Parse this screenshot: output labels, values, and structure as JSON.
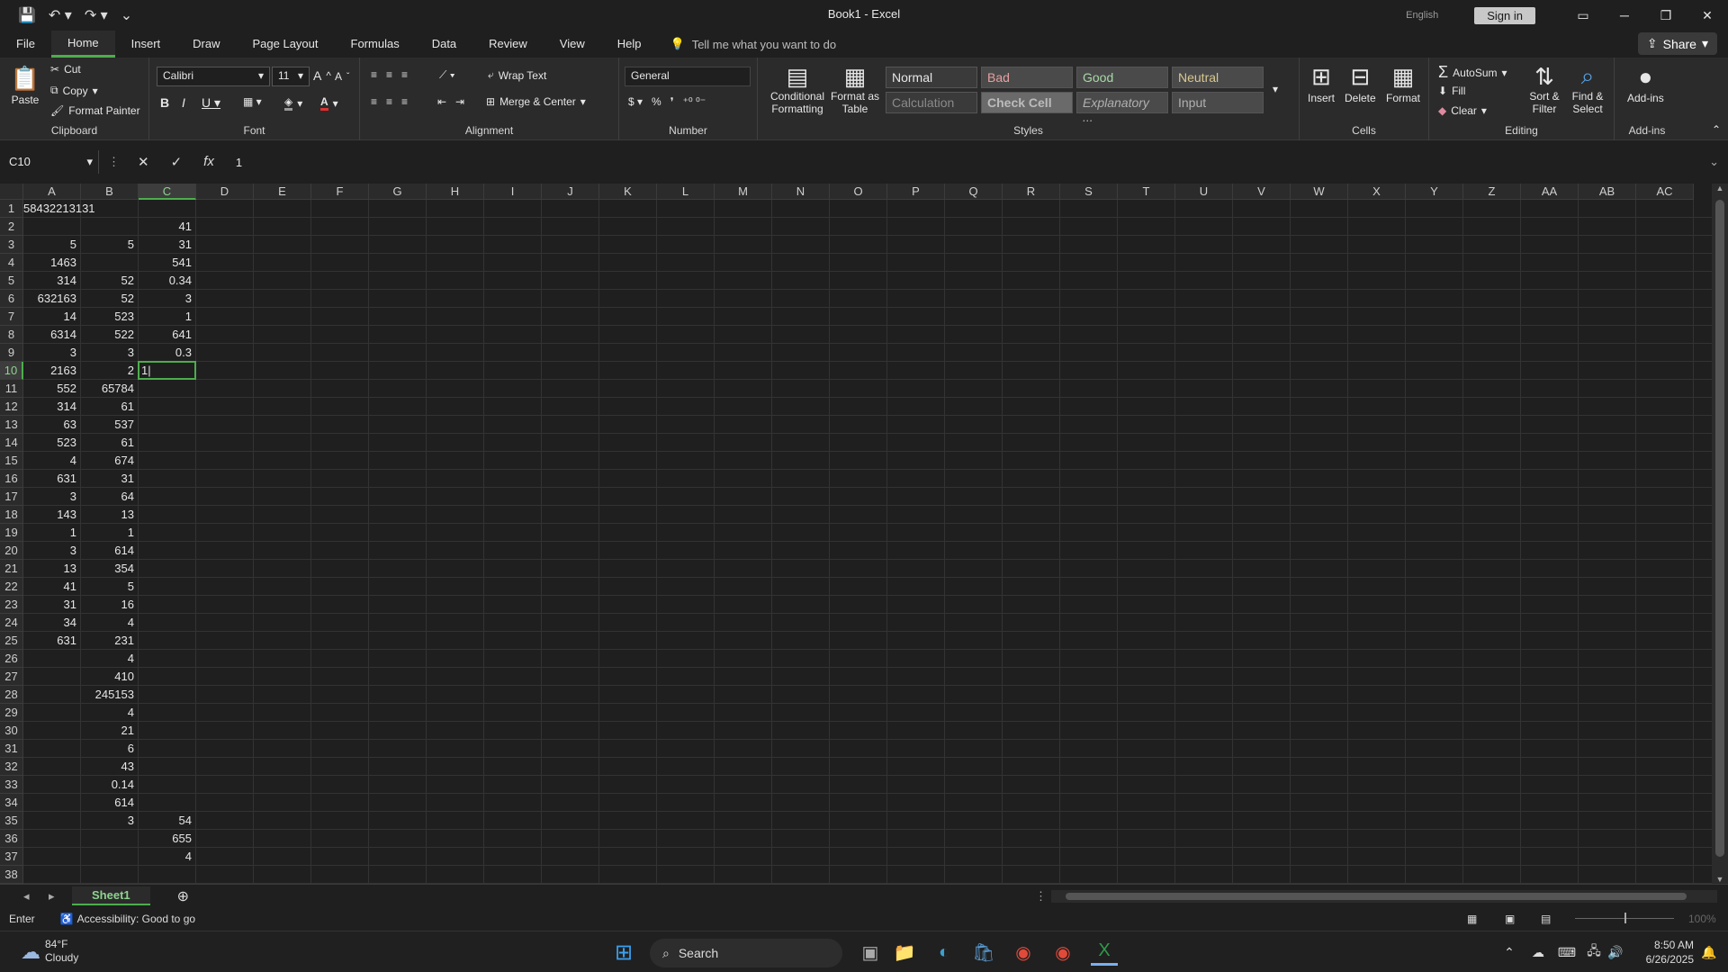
{
  "window": {
    "title": "Book1  -  Excel",
    "language": "English",
    "signin_label": "Sign in"
  },
  "tabs": [
    "File",
    "Home",
    "Insert",
    "Draw",
    "Page Layout",
    "Formulas",
    "Data",
    "Review",
    "View",
    "Help"
  ],
  "tellme": "Tell me what you want to do",
  "share_label": "Share",
  "ribbon": {
    "clipboard": {
      "paste": "Paste",
      "cut": "Cut",
      "copy": "Copy",
      "format_painter": "Format Painter",
      "label": "Clipboard"
    },
    "font": {
      "name": "Calibri",
      "size": "11",
      "label": "Font"
    },
    "alignment": {
      "wrap": "Wrap Text",
      "merge": "Merge & Center",
      "label": "Alignment"
    },
    "number": {
      "format": "General",
      "label": "Number"
    },
    "styles": {
      "conditional": "Conditional Formatting",
      "format_as_table": "Format as Table",
      "cells": [
        "Normal",
        "Bad",
        "Good",
        "Neutral",
        "Calculation",
        "Check Cell",
        "Explanatory ...",
        "Input"
      ],
      "label": "Styles"
    },
    "cells": {
      "insert": "Insert",
      "delete": "Delete",
      "format": "Format",
      "label": "Cells"
    },
    "editing": {
      "autosum": "AutoSum",
      "fill": "Fill",
      "clear": "Clear",
      "sort": "Sort & Filter",
      "find": "Find & Select",
      "label": "Editing"
    },
    "addins": {
      "addins": "Add-ins",
      "label": "Add-ins"
    }
  },
  "formula_bar": {
    "name_box": "C10",
    "formula": "1"
  },
  "columns": [
    "A",
    "B",
    "C",
    "D",
    "E",
    "F",
    "G",
    "H",
    "I",
    "J",
    "K",
    "L",
    "M",
    "N",
    "O",
    "P",
    "Q",
    "R",
    "S",
    "T",
    "U",
    "V",
    "W",
    "X",
    "Y",
    "Z",
    "AA",
    "AB",
    "AC"
  ],
  "rows": [
    "1",
    "2",
    "3",
    "4",
    "5",
    "6",
    "7",
    "8",
    "9",
    "10",
    "11",
    "12",
    "13",
    "14",
    "15",
    "16",
    "17",
    "18",
    "19",
    "20",
    "21",
    "22",
    "23",
    "24",
    "25",
    "26",
    "27",
    "28",
    "29",
    "30",
    "31",
    "32",
    "33",
    "34",
    "35",
    "36",
    "37",
    "38"
  ],
  "col_a": [
    "58432213131",
    "",
    "5",
    "1463",
    "314",
    "632163",
    "14",
    "6314",
    "3",
    "2163",
    "552",
    "314",
    "63",
    "523",
    "4",
    "631",
    "3",
    "143",
    "1",
    "3",
    "13",
    "41",
    "31",
    "34",
    "631",
    "",
    "",
    "",
    "",
    "",
    "",
    "",
    "",
    "",
    "",
    "",
    "",
    ""
  ],
  "col_b": [
    "",
    "",
    "5",
    "",
    "52",
    "52",
    "523",
    "522",
    "3",
    "2",
    "65784",
    "61",
    "537",
    "61",
    "674",
    "31",
    "64",
    "13",
    "1",
    "614",
    "354",
    "5",
    "16",
    "4",
    "231",
    "4",
    "410",
    "245153",
    "4",
    "21",
    "6",
    "43",
    "0.14",
    "614",
    "3",
    "",
    "",
    ""
  ],
  "col_c": [
    "",
    "41",
    "31",
    "541",
    "0.34",
    "3",
    "1",
    "641",
    "0.3",
    "1",
    "",
    "",
    "",
    "",
    "",
    "",
    "",
    "",
    "",
    "",
    "",
    "",
    "",
    "",
    "",
    "",
    "",
    "",
    "",
    "",
    "",
    "",
    "",
    "",
    "54",
    "655",
    "4",
    ""
  ],
  "sheet_name": "Sheet1",
  "status": {
    "mode": "Enter",
    "accessibility": "Accessibility: Good to go",
    "zoom": "100%"
  },
  "taskbar": {
    "weather_temp": "84°F",
    "weather_desc": "Cloudy",
    "search": "Search",
    "time": "8:50 AM",
    "date": "6/26/2025"
  }
}
